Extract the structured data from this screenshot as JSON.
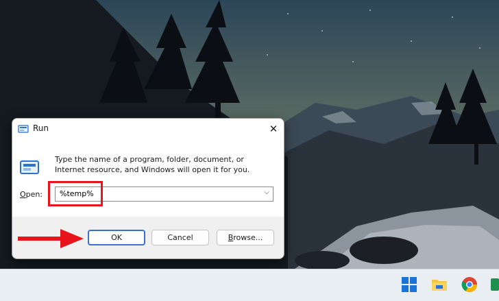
{
  "dialog": {
    "title": "Run",
    "description": "Type the name of a program, folder, document, or Internet resource, and Windows will open it for you.",
    "open_label_mnemonic": "O",
    "open_label_rest": "pen:",
    "open_value": "%temp%",
    "ok_label": "OK",
    "cancel_label": "Cancel",
    "browse_label_mnemonic": "B",
    "browse_label_rest": "rowse..."
  },
  "taskbar": {
    "icons": [
      "windows-start-icon",
      "file-explorer-icon",
      "chrome-icon",
      "app-icon"
    ]
  },
  "colors": {
    "highlight": "#e8141c",
    "arrow": "#e8141c",
    "ok_border": "#3a6fd0"
  }
}
